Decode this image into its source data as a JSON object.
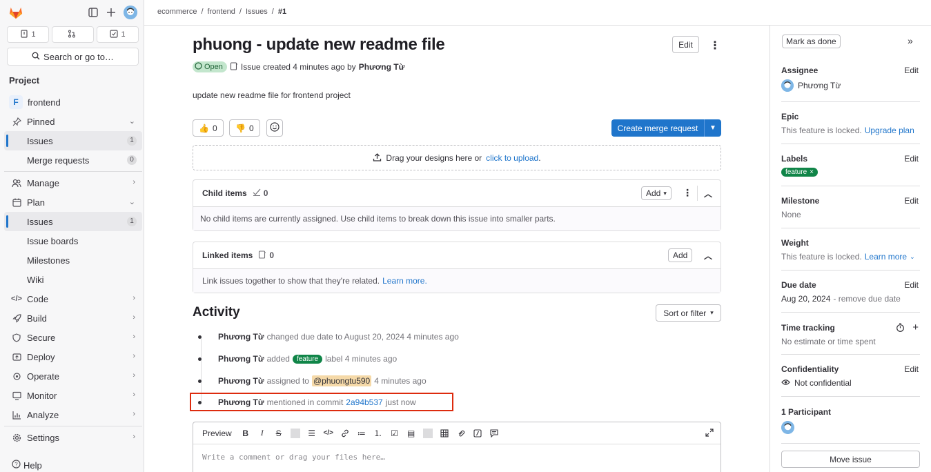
{
  "sidebar": {
    "counts": {
      "issues": "1",
      "merge_requests": "",
      "todos": "1"
    },
    "search_label": "Search or go to…",
    "section_heading": "Project",
    "project_letter": "F",
    "project_name": "frontend",
    "pinned_label": "Pinned",
    "pinned_issues_label": "Issues",
    "pinned_issues_count": "1",
    "pinned_mr_label": "Merge requests",
    "pinned_mr_count": "0",
    "manage_label": "Manage",
    "plan_label": "Plan",
    "plan_issues_label": "Issues",
    "plan_issues_count": "1",
    "issue_boards_label": "Issue boards",
    "milestones_label": "Milestones",
    "wiki_label": "Wiki",
    "code_label": "Code",
    "build_label": "Build",
    "secure_label": "Secure",
    "deploy_label": "Deploy",
    "operate_label": "Operate",
    "monitor_label": "Monitor",
    "analyze_label": "Analyze",
    "settings_label": "Settings",
    "help_label": "Help"
  },
  "breadcrumb": {
    "group": "ecommerce",
    "project": "frontend",
    "section": "Issues",
    "current": "#1",
    "separator": "/"
  },
  "issue": {
    "title": "phuong - update new readme file",
    "edit_label": "Edit",
    "status": "Open",
    "created_text": "Issue created 4 minutes ago by",
    "author": "Phương Từ",
    "description": "update new readme file for frontend project",
    "thumbs_up_count": "0",
    "thumbs_down_count": "0",
    "create_mr_label": "Create merge request",
    "upload_text": "Drag your designs here or",
    "upload_link": "click to upload",
    "upload_period": "."
  },
  "child_items": {
    "title": "Child items",
    "count": "0",
    "add_label": "Add",
    "empty_text": "No child items are currently assigned. Use child items to break down this issue into smaller parts."
  },
  "linked_items": {
    "title": "Linked items",
    "count": "0",
    "add_label": "Add",
    "empty_text": "Link issues together to show that they're related.",
    "learn_more": "Learn more."
  },
  "activity": {
    "heading": "Activity",
    "sort_label": "Sort or filter",
    "items": [
      {
        "who": "Phương Từ",
        "text": "changed due date to August 20, 2024 4 minutes ago"
      },
      {
        "who": "Phương Từ",
        "pre": "added",
        "label": "feature",
        "post": "label 4 minutes ago"
      },
      {
        "who": "Phương Từ",
        "pre": "assigned to",
        "mention": "@phuongtu590",
        "post": "4 minutes ago"
      },
      {
        "who": "Phương Từ",
        "pre": "mentioned in commit",
        "commit": "2a94b537",
        "post": "just now"
      }
    ]
  },
  "editor": {
    "preview_label": "Preview",
    "placeholder": "Write a comment or drag your files here…"
  },
  "right": {
    "mark_done": "Mark as done",
    "assignee_title": "Assignee",
    "assignee_name": "Phương Từ",
    "edit_label": "Edit",
    "epic_title": "Epic",
    "epic_locked": "This feature is locked.",
    "epic_upgrade": "Upgrade plan",
    "labels_title": "Labels",
    "label_feature": "feature",
    "milestone_title": "Milestone",
    "milestone_value": "None",
    "weight_title": "Weight",
    "weight_locked": "This feature is locked.",
    "weight_learn": "Learn more",
    "due_title": "Due date",
    "due_value": "Aug 20, 2024",
    "due_remove": "- remove due date",
    "time_title": "Time tracking",
    "time_value": "No estimate or time spent",
    "conf_title": "Confidentiality",
    "conf_value": "Not confidential",
    "participants_title": "1 Participant",
    "move_label": "Move issue"
  },
  "colors": {
    "accent": "#1f75cb",
    "label_green": "#108548",
    "highlight_red": "#dd2b0e",
    "logo_orange": "#fc6d26"
  }
}
